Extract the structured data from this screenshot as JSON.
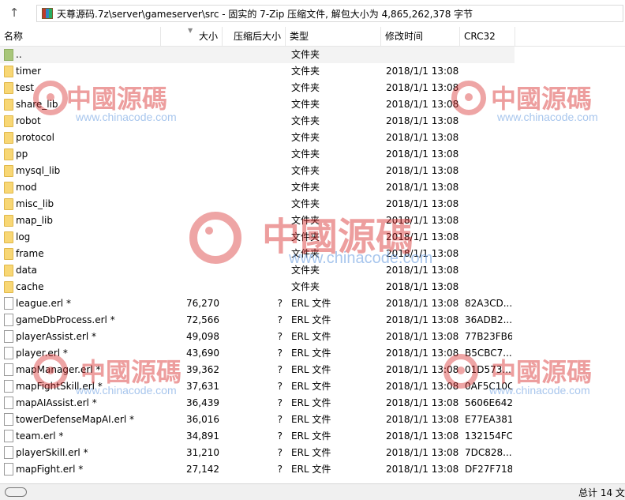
{
  "toolbar": {
    "up_icon": "up-arrow-icon",
    "path": "天尊源码.7z\\server\\gameserver\\src - 固实的 7-Zip 压缩文件, 解包大小为 4,865,262,378 字节"
  },
  "columns": {
    "name": "名称",
    "size": "大小",
    "packed": "压缩后大小",
    "type": "类型",
    "modified": "修改时间",
    "crc": "CRC32"
  },
  "rows": [
    {
      "name": "..",
      "size": "",
      "packed": "",
      "type": "文件夹",
      "modified": "",
      "crc": "",
      "icon": "parent-folder"
    },
    {
      "name": "timer",
      "size": "",
      "packed": "",
      "type": "文件夹",
      "modified": "2018/1/1 13:08",
      "crc": "",
      "icon": "folder"
    },
    {
      "name": "test",
      "size": "",
      "packed": "",
      "type": "文件夹",
      "modified": "2018/1/1 13:08",
      "crc": "",
      "icon": "folder"
    },
    {
      "name": "share_lib",
      "size": "",
      "packed": "",
      "type": "文件夹",
      "modified": "2018/1/1 13:08",
      "crc": "",
      "icon": "folder"
    },
    {
      "name": "robot",
      "size": "",
      "packed": "",
      "type": "文件夹",
      "modified": "2018/1/1 13:08",
      "crc": "",
      "icon": "folder"
    },
    {
      "name": "protocol",
      "size": "",
      "packed": "",
      "type": "文件夹",
      "modified": "2018/1/1 13:08",
      "crc": "",
      "icon": "folder"
    },
    {
      "name": "pp",
      "size": "",
      "packed": "",
      "type": "文件夹",
      "modified": "2018/1/1 13:08",
      "crc": "",
      "icon": "folder"
    },
    {
      "name": "mysql_lib",
      "size": "",
      "packed": "",
      "type": "文件夹",
      "modified": "2018/1/1 13:08",
      "crc": "",
      "icon": "folder"
    },
    {
      "name": "mod",
      "size": "",
      "packed": "",
      "type": "文件夹",
      "modified": "2018/1/1 13:08",
      "crc": "",
      "icon": "folder"
    },
    {
      "name": "misc_lib",
      "size": "",
      "packed": "",
      "type": "文件夹",
      "modified": "2018/1/1 13:08",
      "crc": "",
      "icon": "folder"
    },
    {
      "name": "map_lib",
      "size": "",
      "packed": "",
      "type": "文件夹",
      "modified": "2018/1/1 13:08",
      "crc": "",
      "icon": "folder"
    },
    {
      "name": "log",
      "size": "",
      "packed": "",
      "type": "文件夹",
      "modified": "2018/1/1 13:08",
      "crc": "",
      "icon": "folder"
    },
    {
      "name": "frame",
      "size": "",
      "packed": "",
      "type": "文件夹",
      "modified": "2018/1/1 13:08",
      "crc": "",
      "icon": "folder"
    },
    {
      "name": "data",
      "size": "",
      "packed": "",
      "type": "文件夹",
      "modified": "2018/1/1 13:08",
      "crc": "",
      "icon": "folder"
    },
    {
      "name": "cache",
      "size": "",
      "packed": "",
      "type": "文件夹",
      "modified": "2018/1/1 13:08",
      "crc": "",
      "icon": "folder"
    },
    {
      "name": "league.erl *",
      "size": "76,270",
      "packed": "?",
      "type": "ERL 文件",
      "modified": "2018/1/1 13:08",
      "crc": "82A3CD...",
      "icon": "file"
    },
    {
      "name": "gameDbProcess.erl *",
      "size": "72,566",
      "packed": "?",
      "type": "ERL 文件",
      "modified": "2018/1/1 13:08",
      "crc": "36ADB2...",
      "icon": "file"
    },
    {
      "name": "playerAssist.erl *",
      "size": "49,098",
      "packed": "?",
      "type": "ERL 文件",
      "modified": "2018/1/1 13:08",
      "crc": "77B23FB6",
      "icon": "file"
    },
    {
      "name": "player.erl *",
      "size": "43,690",
      "packed": "?",
      "type": "ERL 文件",
      "modified": "2018/1/1 13:08",
      "crc": "B5CBC7...",
      "icon": "file"
    },
    {
      "name": "mapManager.erl *",
      "size": "39,362",
      "packed": "?",
      "type": "ERL 文件",
      "modified": "2018/1/1 13:08",
      "crc": "01D573...",
      "icon": "file"
    },
    {
      "name": "mapFightSkill.erl *",
      "size": "37,631",
      "packed": "?",
      "type": "ERL 文件",
      "modified": "2018/1/1 13:08",
      "crc": "0AF5C10C",
      "icon": "file"
    },
    {
      "name": "mapAIAssist.erl *",
      "size": "36,439",
      "packed": "?",
      "type": "ERL 文件",
      "modified": "2018/1/1 13:08",
      "crc": "5606E642",
      "icon": "file"
    },
    {
      "name": "towerDefenseMapAI.erl *",
      "size": "36,016",
      "packed": "?",
      "type": "ERL 文件",
      "modified": "2018/1/1 13:08",
      "crc": "E77EA381",
      "icon": "file"
    },
    {
      "name": "team.erl *",
      "size": "34,891",
      "packed": "?",
      "type": "ERL 文件",
      "modified": "2018/1/1 13:08",
      "crc": "132154FC",
      "icon": "file"
    },
    {
      "name": "playerSkill.erl *",
      "size": "31,210",
      "packed": "?",
      "type": "ERL 文件",
      "modified": "2018/1/1 13:08",
      "crc": "7DC828...",
      "icon": "file"
    },
    {
      "name": "mapFight.erl *",
      "size": "27,142",
      "packed": "?",
      "type": "ERL 文件",
      "modified": "2018/1/1 13:08",
      "crc": "DF27F718",
      "icon": "file"
    }
  ],
  "status": {
    "total": "总计 14 文"
  },
  "watermark": {
    "logo_icon": "biohazard-logo-icon",
    "text": "中國源碼",
    "url": "www.chinacode.com",
    "color": "#d72828"
  }
}
